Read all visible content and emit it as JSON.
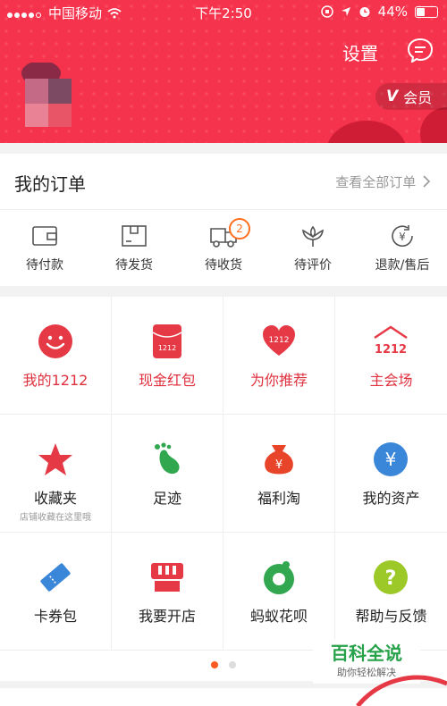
{
  "status_bar": {
    "carrier": "中国移动",
    "time": "下午2:50",
    "battery": "44%",
    "battery_level": 0.44
  },
  "header": {
    "settings_label": "设置",
    "vip_prefix": "V",
    "vip_label": "会员"
  },
  "orders": {
    "title": "我的订单",
    "view_all": "查看全部订单",
    "items": [
      {
        "label": "待付款",
        "icon": "wallet-icon"
      },
      {
        "label": "待发货",
        "icon": "package-icon"
      },
      {
        "label": "待收货",
        "icon": "truck-icon",
        "badge": "2"
      },
      {
        "label": "待评价",
        "icon": "flower-icon"
      },
      {
        "label": "退款/售后",
        "icon": "refund-icon"
      }
    ]
  },
  "grid": {
    "items": [
      {
        "label": "我的1212",
        "icon": "smiley-icon",
        "accent": "#e0313f"
      },
      {
        "label": "现金红包",
        "icon": "red-envelope-icon",
        "accent": "#e0313f"
      },
      {
        "label": "为你推荐",
        "icon": "heart-icon",
        "accent": "#e0313f"
      },
      {
        "label": "主会场",
        "icon": "house-1212-icon",
        "accent": "#e0313f"
      },
      {
        "label": "收藏夹",
        "sub": "店铺收藏在这里哦",
        "icon": "star-icon"
      },
      {
        "label": "足迹",
        "icon": "footprint-icon"
      },
      {
        "label": "福利淘",
        "icon": "money-bag-icon"
      },
      {
        "label": "我的资产",
        "icon": "yen-coin-icon"
      },
      {
        "label": "卡券包",
        "icon": "ticket-icon"
      },
      {
        "label": "我要开店",
        "icon": "shop-icon"
      },
      {
        "label": "蚂蚁花呗",
        "icon": "ant-flower-icon"
      },
      {
        "label": "帮助与反馈",
        "icon": "question-icon"
      }
    ]
  },
  "watermark": {
    "title": "百科全说",
    "subtitle": "助你轻松解决"
  },
  "colors": {
    "brand_red": "#f5334d",
    "orange": "#ff6d1f",
    "green": "#27a24a"
  }
}
